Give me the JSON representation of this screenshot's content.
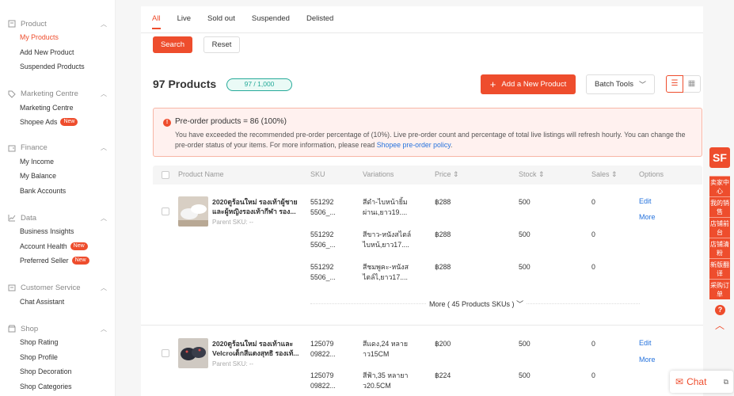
{
  "sidebar": {
    "sections": [
      {
        "title": "Product",
        "icon": "box-icon",
        "items": [
          "My Products",
          "Add New Product",
          "Suspended Products"
        ]
      },
      {
        "title": "Marketing Centre",
        "icon": "tag-icon",
        "items": [
          "Marketing Centre",
          "Shopee Ads"
        ]
      },
      {
        "title": "Finance",
        "icon": "wallet-icon",
        "items": [
          "My Income",
          "My Balance",
          "Bank Accounts"
        ]
      },
      {
        "title": "Data",
        "icon": "chart-icon",
        "items": [
          "Business Insights",
          "Account Health",
          "Preferred Seller"
        ]
      },
      {
        "title": "Customer Service",
        "icon": "chat-icon",
        "items": [
          "Chat Assistant"
        ]
      },
      {
        "title": "Shop",
        "icon": "shop-icon",
        "items": [
          "Shop Rating",
          "Shop Profile",
          "Shop Decoration",
          "Shop Categories"
        ]
      }
    ],
    "new_badge": "New"
  },
  "tabs": [
    "All",
    "Live",
    "Sold out",
    "Suspended",
    "Delisted"
  ],
  "filter": {
    "search_label": "Search",
    "reset_label": "Reset"
  },
  "header": {
    "product_count": "97 Products",
    "quota": "97 / 1,000",
    "add_label": "Add a New Product",
    "batch_label": "Batch Tools"
  },
  "alert": {
    "title": "Pre-order products = 86 (100%)",
    "body": "You have exceeded the recommended pre-order percentage of (10%). Live pre-order count and percentage of total live listings will refresh hourly. You can change the pre-order status of your items. For more information, please read",
    "link": "Shopee pre-order policy",
    "tail": "."
  },
  "table": {
    "columns": [
      "Product Name",
      "SKU",
      "Variations",
      "Price",
      "Stock",
      "Sales",
      "Options"
    ],
    "products": [
      {
        "name": "2020ดูร้อนใหม่ รองเท้าผู้ชายและผู้หญิงรองเท้ากีฬา รอง...",
        "parent_sku": "Parent SKU: --",
        "variants": [
          {
            "sku": "551292 5506_...",
            "variation": "สีดำ-ไบหน้ายิ้ม ผ่านเ,ยาว19....",
            "price": "฿288",
            "stock": "500",
            "sales": "0"
          },
          {
            "sku": "551292 5506_...",
            "variation": "สีขาว-หนังสไตล์ ไบหน้,ยาว17....",
            "price": "฿288",
            "stock": "500",
            "sales": "0"
          },
          {
            "sku": "551292 5506_...",
            "variation": "สีชมพูคะ-หนังส ไตล์ไ,ยาว17....",
            "price": "฿288",
            "stock": "500",
            "sales": "0"
          }
        ],
        "more": "More ( 45 Products SKUs )"
      },
      {
        "name": "2020ดูร้อนใหม่ รองเท้าและ Velcroเด็กสีแดงสุทธิ รองเท้...",
        "parent_sku": "Parent SKU: --",
        "variants": [
          {
            "sku": "125079 09822...",
            "variation": "สีแดง,24 หลาย าว15CM",
            "price": "฿200",
            "stock": "500",
            "sales": "0"
          },
          {
            "sku": "125079 09822...",
            "variation": "สีฟ้า,35 หลายา ว20.5CM",
            "price": "฿224",
            "stock": "500",
            "sales": "0"
          }
        ]
      }
    ],
    "edit_label": "Edit",
    "more_label": "More"
  },
  "rightbar": {
    "logo": "SF",
    "items": [
      "卖家中心",
      "我的销售",
      "店铺前台",
      "店铺清粉",
      "新版翻译",
      "采购订单"
    ]
  },
  "chat": {
    "label": "Chat"
  },
  "colors": {
    "accent": "#ee4d2d",
    "link": "#2673dd",
    "teal": "#26aa99"
  }
}
